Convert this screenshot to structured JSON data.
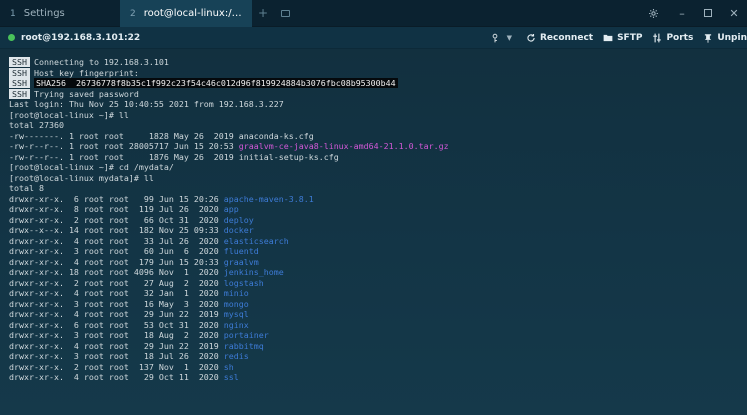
{
  "tabs": [
    {
      "num": "1",
      "label": "Settings",
      "active": false
    },
    {
      "num": "2",
      "label": "root@local-linux:/myd...",
      "active": true
    }
  ],
  "toolbar": {
    "session_label": "root@192.168.3.101:22",
    "reconnect_label": "Reconnect",
    "sftp_label": "SFTP",
    "ports_label": "Ports",
    "unpin_label": "Unpin"
  },
  "colors": {
    "connected": "#49c25a",
    "directory": "#3d7bd6",
    "archive": "#d158d6"
  },
  "terminal": {
    "ssh_lines": [
      {
        "badge": "SSH",
        "text": "Connecting to 192.168.3.101"
      },
      {
        "badge": "SSH",
        "text": "Host key fingerprint:"
      },
      {
        "badge": "SSH",
        "text": "SHA256  26736778f8b35c1f992c23f54c46c012d96f819924884b3076fbc08b95300b44"
      },
      {
        "badge": "SSH",
        "text": "Trying saved password"
      }
    ],
    "login_line": "Last login: Thu Nov 25 10:40:55 2021 from 192.168.3.227",
    "prompt1": "[root@local-linux ~]# ll",
    "total1": "total 27360",
    "home_files": [
      {
        "meta": "-rw-------. 1 root root     1828 May 26  2019 ",
        "name": "anaconda-ks.cfg",
        "kind": "file"
      },
      {
        "meta": "-rw-r--r--. 1 root root 28005717 Jun 15 20:53 ",
        "name": "graalvm-ce-java8-linux-amd64-21.1.0.tar.gz",
        "kind": "archive"
      },
      {
        "meta": "-rw-r--r--. 1 root root     1876 May 26  2019 ",
        "name": "initial-setup-ks.cfg",
        "kind": "file"
      }
    ],
    "prompt2": "[root@local-linux ~]# cd /mydata/",
    "prompt3": "[root@local-linux mydata]# ll",
    "total2": "total 8",
    "dirs": [
      {
        "meta": "drwxr-xr-x.  6 root root   99 Jun 15 20:26 ",
        "name": "apache-maven-3.8.1"
      },
      {
        "meta": "drwxr-xr-x.  8 root root  119 Jul 26  2020 ",
        "name": "app"
      },
      {
        "meta": "drwxr-xr-x.  2 root root   66 Oct 31  2020 ",
        "name": "deploy"
      },
      {
        "meta": "drwx--x--x. 14 root root  182 Nov 25 09:33 ",
        "name": "docker"
      },
      {
        "meta": "drwxr-xr-x.  4 root root   33 Jul 26  2020 ",
        "name": "elasticsearch"
      },
      {
        "meta": "drwxr-xr-x.  3 root root   60 Jun  6  2020 ",
        "name": "fluentd"
      },
      {
        "meta": "drwxr-xr-x.  4 root root  179 Jun 15 20:33 ",
        "name": "graalvm"
      },
      {
        "meta": "drwxr-xr-x. 18 root root 4096 Nov  1  2020 ",
        "name": "jenkins_home"
      },
      {
        "meta": "drwxr-xr-x.  2 root root   27 Aug  2  2020 ",
        "name": "logstash"
      },
      {
        "meta": "drwxr-xr-x.  4 root root   32 Jan  1  2020 ",
        "name": "minio"
      },
      {
        "meta": "drwxr-xr-x.  3 root root   16 May  3  2020 ",
        "name": "mongo"
      },
      {
        "meta": "drwxr-xr-x.  4 root root   29 Jun 22  2019 ",
        "name": "mysql"
      },
      {
        "meta": "drwxr-xr-x.  6 root root   53 Oct 31  2020 ",
        "name": "nginx"
      },
      {
        "meta": "drwxr-xr-x.  3 root root   18 Aug  2  2020 ",
        "name": "portainer"
      },
      {
        "meta": "drwxr-xr-x.  4 root root   29 Jun 22  2019 ",
        "name": "rabbitmq"
      },
      {
        "meta": "drwxr-xr-x.  3 root root   18 Jul 26  2020 ",
        "name": "redis"
      },
      {
        "meta": "drwxr-xr-x.  2 root root  137 Nov  1  2020 ",
        "name": "sh"
      },
      {
        "meta": "drwxr-xr-x.  4 root root   29 Oct 11  2020 ",
        "name": "ssl"
      }
    ]
  }
}
